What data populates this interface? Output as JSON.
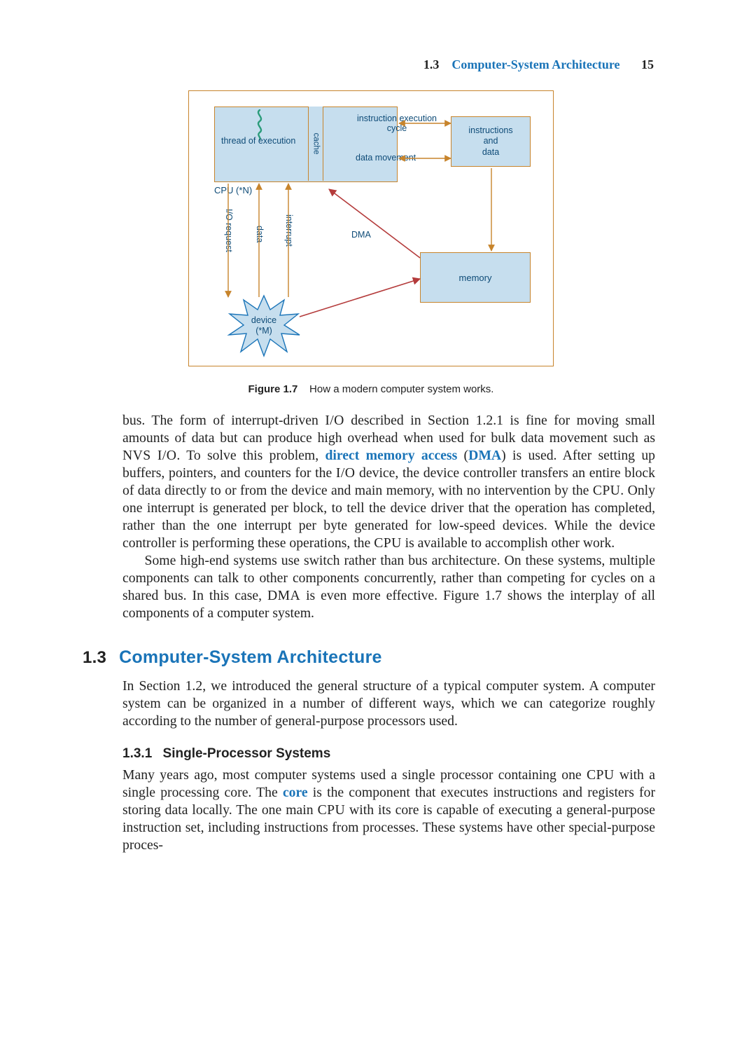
{
  "header": {
    "section_number": "1.3",
    "section_name": "Computer-System Architecture",
    "page_number": "15"
  },
  "figure": {
    "cpu_label": "CPU (*N)",
    "thread_label": "thread of execution",
    "cache_label": "cache",
    "instr_exec_label": "instruction execution\ncycle",
    "data_move_label": "data movement",
    "instrdata_label": "instructions\nand\ndata",
    "memory_label": "memory",
    "dma_label": "DMA",
    "io_request_label": "I/O request",
    "data_label": "data",
    "interrupt_label": "interrupt",
    "device_label": "device\n(*M)",
    "caption_bold": "Figure 1.7",
    "caption_rest": "How a modern computer system works."
  },
  "para1_a": "bus. The form of interrupt-driven ",
  "para1_b": " described in Section 1.2.1 is fine for moving small amounts of data but can produce high overhead when used for bulk data movement such as ",
  "para1_c": ". To solve this problem, ",
  "para1_term1": "direct memory access",
  "para1_d": " (",
  "para1_term2": "DMA",
  "para1_e": ") is used. After setting up buffers, pointers, and counters for the ",
  "para1_f": " device, the device controller transfers an entire block of data directly to or from the device and main memory, with no intervention by the ",
  "para1_g": ". Only one interrupt is generated per block, to tell the device driver that the operation has completed, rather than the one interrupt per byte generated for low-speed devices. While the device controller is performing these operations, the ",
  "para1_h": " is available to accomplish other work.",
  "sc_io": "I/O",
  "sc_nvs": "NVS",
  "sc_cpu": "CPU",
  "para2": "Some high-end systems use switch rather than bus architecture. On these systems, multiple components can talk to other components concurrently, rather than competing for cycles on a shared bus. In this case, ",
  "para2_b": " is even more effective. Figure 1.7 shows the interplay of all components of a computer system.",
  "sc_dma": "DMA",
  "section": {
    "num": "1.3",
    "title": "Computer-System Architecture"
  },
  "para3": "In Section 1.2, we introduced the general structure of a typical computer system. A computer system can be organized in a number of different ways, which we can categorize roughly according to the number of general-purpose processors used.",
  "subsection": {
    "num": "1.3.1",
    "title": "Single-Processor Systems"
  },
  "para4_a": "Many years ago, most computer systems used a single processor containing one ",
  "para4_b": " with a single processing core. The ",
  "para4_term": "core",
  "para4_c": " is the component that executes instructions and registers for storing data locally. The one main ",
  "para4_d": " with its core is capable of executing a general-purpose instruction set, including instructions from processes. These systems have other special-purpose proces-"
}
